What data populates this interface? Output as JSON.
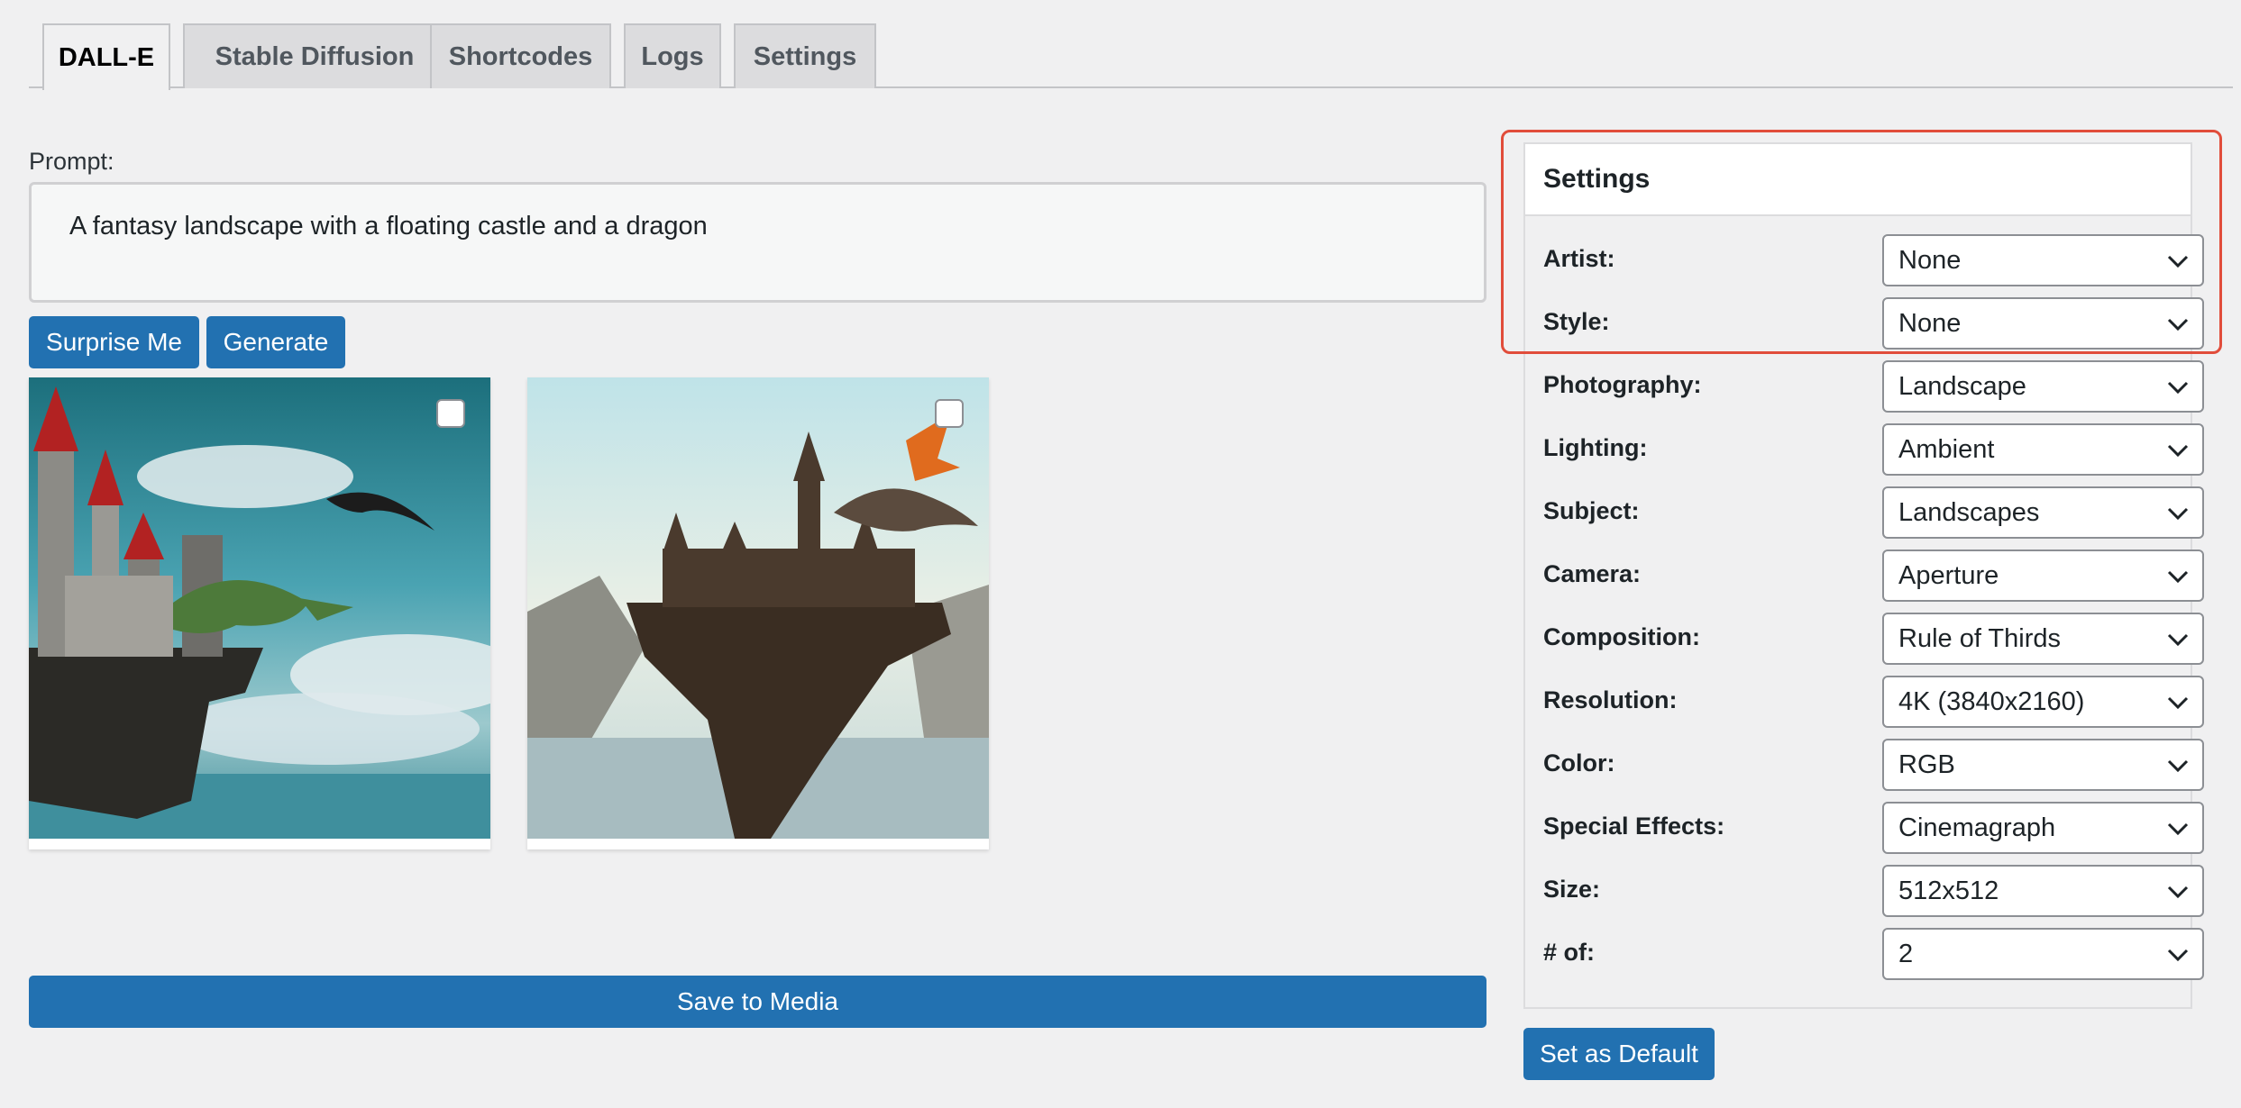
{
  "tabs": [
    {
      "label": "DALL-E",
      "active": true
    },
    {
      "label": "Stable Diffusion",
      "active": false
    },
    {
      "label": "Shortcodes",
      "active": false
    },
    {
      "label": "Logs",
      "active": false
    },
    {
      "label": "Settings",
      "active": false
    }
  ],
  "prompt": {
    "label": "Prompt:",
    "value": "A fantasy landscape with a floating castle and a dragon"
  },
  "actions": {
    "surprise_label": "Surprise Me",
    "generate_label": "Generate",
    "save_label": "Save to Media",
    "set_default_label": "Set as Default"
  },
  "images": [
    {
      "icon": "generated-castle-dragon-image-1",
      "checked": false
    },
    {
      "icon": "generated-castle-dragon-image-2",
      "checked": false
    }
  ],
  "settings_panel": {
    "title": "Settings",
    "rows": [
      {
        "label": "Artist:",
        "value": "None"
      },
      {
        "label": "Style:",
        "value": "None"
      },
      {
        "label": "Photography:",
        "value": "Landscape"
      },
      {
        "label": "Lighting:",
        "value": "Ambient"
      },
      {
        "label": "Subject:",
        "value": "Landscapes"
      },
      {
        "label": "Camera:",
        "value": "Aperture"
      },
      {
        "label": "Composition:",
        "value": "Rule of Thirds"
      },
      {
        "label": "Resolution:",
        "value": "4K (3840x2160)"
      },
      {
        "label": "Color:",
        "value": "RGB"
      },
      {
        "label": "Special Effects:",
        "value": "Cinemagraph"
      },
      {
        "label": "Size:",
        "value": "512x512"
      },
      {
        "label": "# of:",
        "value": "2"
      }
    ]
  },
  "colors": {
    "primary": "#2271b1",
    "highlight": "#e14d3b",
    "background": "#f0f0f1"
  }
}
